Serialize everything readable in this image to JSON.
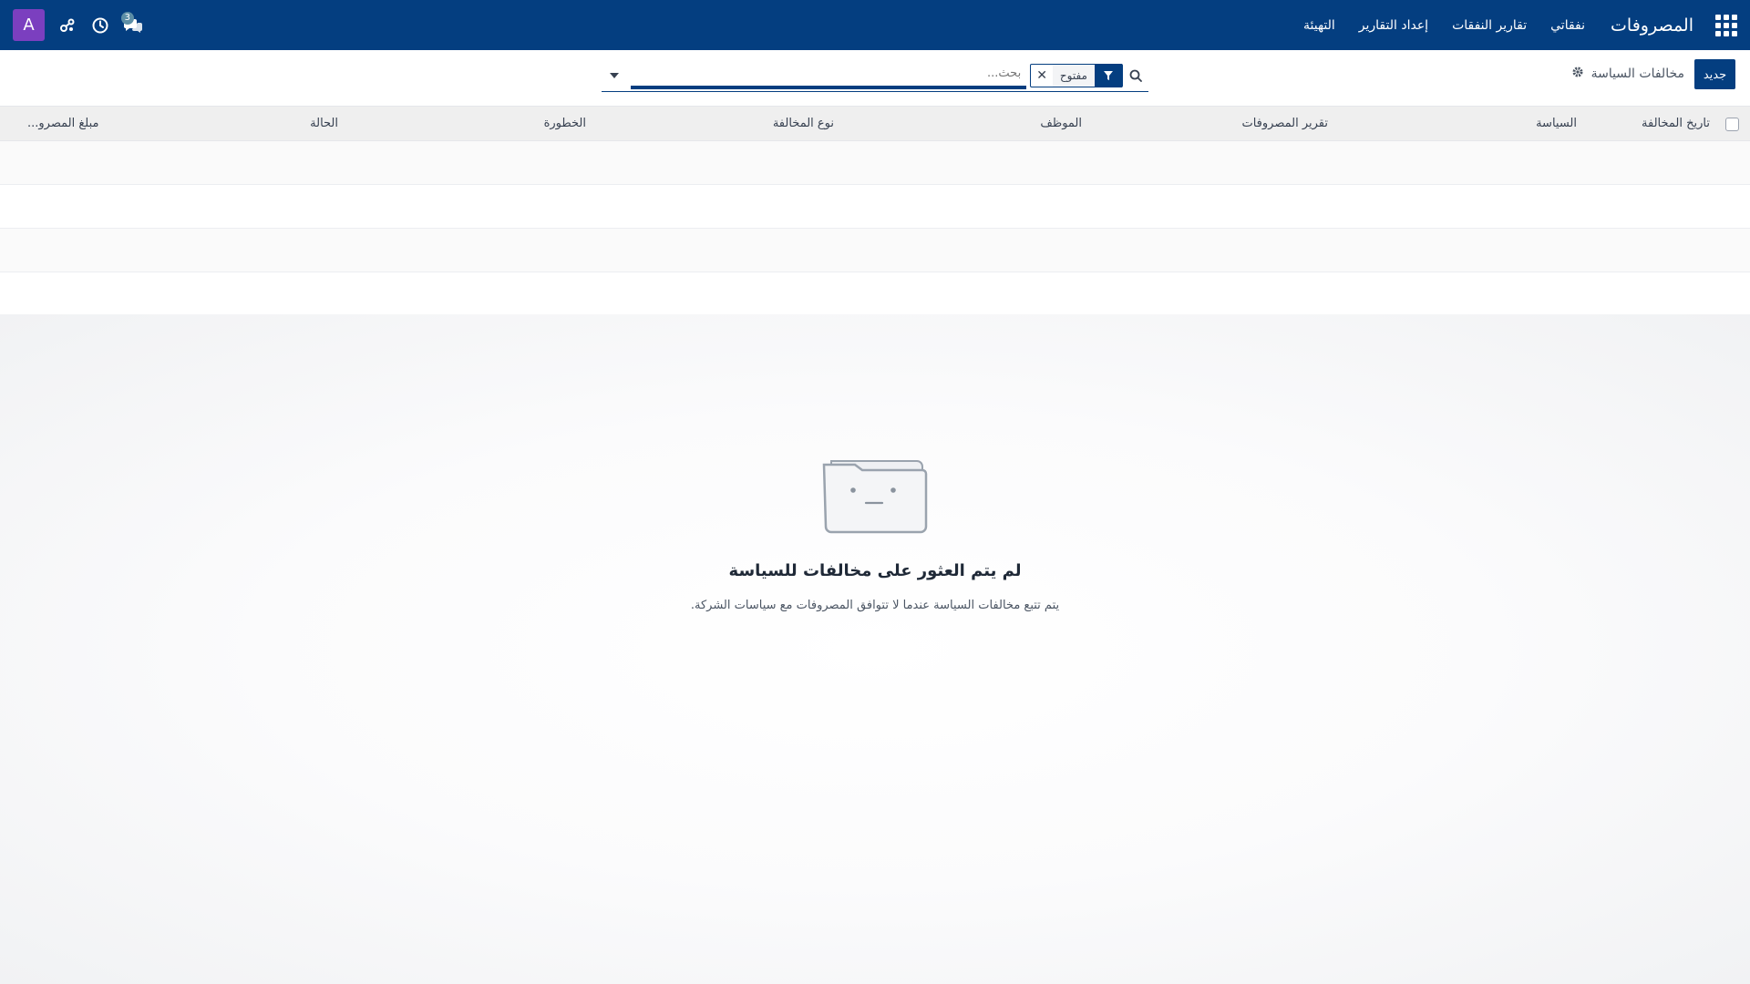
{
  "navbar": {
    "app_name": "المصروفات",
    "menu": [
      "نفقاتي",
      "تقارير النفقات",
      "إعداد التقارير",
      "التهيئة"
    ],
    "messages_badge": "3",
    "avatar_letter": "A",
    "colors": {
      "navbar": "#043e80",
      "avatar": "#7b3fbf"
    }
  },
  "control": {
    "new_label": "جديد",
    "breadcrumb": "مخالفات السياسة",
    "search_facet": "مفتوح",
    "search_placeholder": "بحث..."
  },
  "table": {
    "columns": [
      "تاريخ المخالفة",
      "السياسة",
      "تقرير المصروفات",
      "الموظف",
      "نوع المخالفة",
      "الخطورة",
      "الحالة",
      "مبلغ المصرو..."
    ]
  },
  "empty_state": {
    "title": "لم يتم العثور على مخالفات للسياسة",
    "description": "يتم تتبع مخالفات السياسة عندما لا تتوافق المصروفات مع سياسات الشركة."
  }
}
